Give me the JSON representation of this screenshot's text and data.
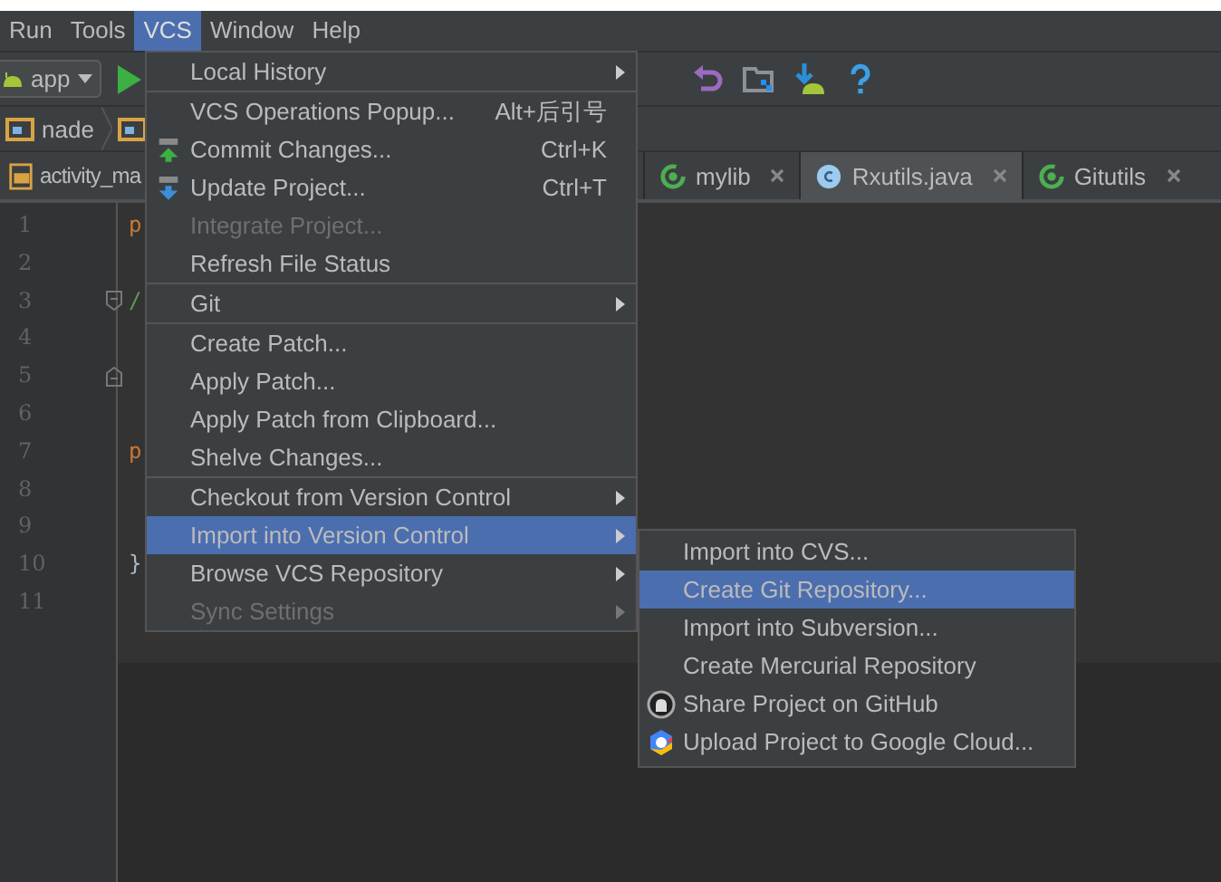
{
  "menu_bar": [
    {
      "label": "Run",
      "selected": false
    },
    {
      "label": "Tools",
      "selected": false
    },
    {
      "label": "VCS",
      "selected": true
    },
    {
      "label": "Window",
      "selected": false
    },
    {
      "label": "Help",
      "selected": false
    }
  ],
  "toolbar": {
    "config": "app"
  },
  "breadcrumb": [
    {
      "label": "nade"
    }
  ],
  "tabs": [
    {
      "label": "activity_ma",
      "selected": false
    },
    {
      "label": "mylib",
      "selected": false,
      "closable": true
    },
    {
      "label": "Rxutils.java",
      "selected": true,
      "closable": true
    },
    {
      "label": "Gitutils",
      "selected": false,
      "closable": true
    }
  ],
  "editor": {
    "lines": [
      {
        "number": "1",
        "code": "p",
        "kind": "keyword"
      },
      {
        "number": "2"
      },
      {
        "number": "3",
        "code": "/",
        "kind": "comment"
      },
      {
        "number": "4"
      },
      {
        "number": "5"
      },
      {
        "number": "6"
      },
      {
        "number": "7",
        "code": "p",
        "kind": "keyword"
      },
      {
        "number": "8"
      },
      {
        "number": "9"
      },
      {
        "number": "10",
        "code": "}",
        "kind": "plain"
      },
      {
        "number": "11"
      }
    ]
  },
  "vcs_menu": [
    {
      "kind": "item",
      "label": "Local History",
      "submenu": true,
      "selected": false,
      "disabled": false
    },
    {
      "kind": "separator"
    },
    {
      "kind": "item",
      "label": "VCS Operations Popup...",
      "shortcut": "Alt+后引号",
      "selected": false,
      "disabled": false
    },
    {
      "kind": "item",
      "label": "Commit Changes...",
      "shortcut": "Ctrl+K",
      "selected": false,
      "disabled": false
    },
    {
      "kind": "item",
      "label": "Update Project...",
      "shortcut": "Ctrl+T",
      "selected": false,
      "disabled": false
    },
    {
      "kind": "item",
      "label": "Integrate Project...",
      "selected": false,
      "disabled": true
    },
    {
      "kind": "item",
      "label": "Refresh File Status",
      "selected": false,
      "disabled": false
    },
    {
      "kind": "separator"
    },
    {
      "kind": "item",
      "label": "Git",
      "submenu": true,
      "selected": false,
      "disabled": false
    },
    {
      "kind": "separator"
    },
    {
      "kind": "item",
      "label": "Create Patch...",
      "selected": false,
      "disabled": false
    },
    {
      "kind": "item",
      "label": "Apply Patch...",
      "selected": false,
      "disabled": false
    },
    {
      "kind": "item",
      "label": "Apply Patch from Clipboard...",
      "selected": false,
      "disabled": false
    },
    {
      "kind": "item",
      "label": "Shelve Changes...",
      "selected": false,
      "disabled": false
    },
    {
      "kind": "separator"
    },
    {
      "kind": "item",
      "label": "Checkout from Version Control",
      "submenu": true,
      "selected": false,
      "disabled": false
    },
    {
      "kind": "item",
      "label": "Import into Version Control",
      "submenu": true,
      "selected": true,
      "disabled": false
    },
    {
      "kind": "item",
      "label": "Browse VCS Repository",
      "submenu": true,
      "selected": false,
      "disabled": false
    },
    {
      "kind": "item",
      "label": "Sync Settings",
      "submenu": true,
      "selected": false,
      "disabled": true
    }
  ],
  "import_submenu": [
    {
      "label": "Import into CVS...",
      "selected": false
    },
    {
      "label": "Create Git Repository...",
      "selected": true
    },
    {
      "label": "Import into Subversion...",
      "selected": false
    },
    {
      "label": "Create Mercurial Repository",
      "selected": false
    },
    {
      "label": "Share Project on GitHub",
      "selected": false
    },
    {
      "label": "Upload Project to Google Cloud...",
      "selected": false
    }
  ]
}
